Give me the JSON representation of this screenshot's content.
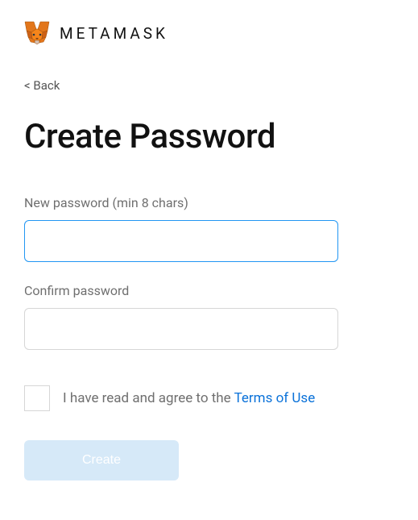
{
  "header": {
    "brand": "METAMASK"
  },
  "nav": {
    "back": "< Back"
  },
  "title": "Create Password",
  "form": {
    "new_password_label": "New password (min 8 chars)",
    "new_password_value": "",
    "confirm_password_label": "Confirm password",
    "confirm_password_value": ""
  },
  "terms": {
    "prefix": "I have read and agree to the ",
    "link": "Terms of Use"
  },
  "buttons": {
    "create": "Create"
  }
}
